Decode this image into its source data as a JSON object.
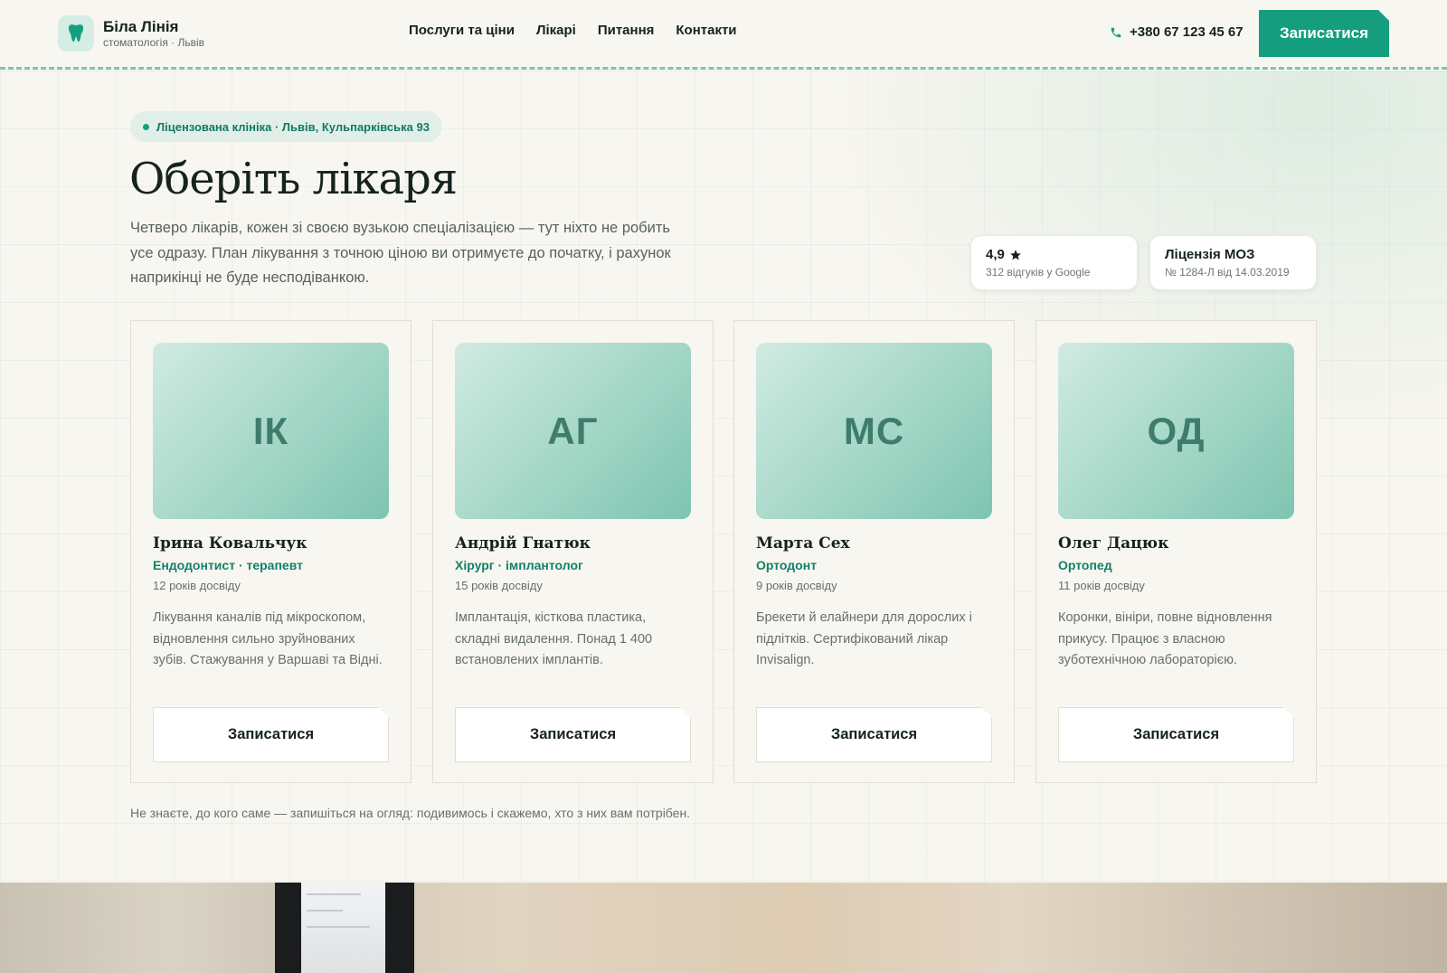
{
  "header": {
    "brand_name": "Біла Лінія",
    "brand_sub": "стоматологія · Львів",
    "nav": [
      "Послуги та ціни",
      "Лікарі",
      "Питання",
      "Контакти"
    ],
    "phone": "+380 67 123 45 67",
    "cta": "Записатися"
  },
  "hero": {
    "badge": "Ліцензована клініка · Львів, Кульпарківська 93",
    "title": "Оберіть лікаря",
    "lead": "Четверо лікарів, кожен зі своєю вузькою спеціалізацією — тут ніхто не робить усе одразу. План лікування з точною ціною ви отримуєте до початку, і рахунок наприкінці не буде несподіванкою."
  },
  "stats": [
    {
      "title": "4,9",
      "sub": "312 відгуків у Google"
    },
    {
      "title": "Ліцензія МОЗ",
      "sub": "№ 1284-Л від 14.03.2019"
    }
  ],
  "doctors": [
    {
      "initials": "ІК",
      "name": "Ірина Ковальчук",
      "spec": "Ендодонтист · терапевт",
      "exp": "12 років досвіду",
      "desc": "Лікування каналів під мікроскопом, відновлення сильно зруйнованих зубів. Стажування у Варшаві та Відні.",
      "button": "Записатися"
    },
    {
      "initials": "АГ",
      "name": "Андрій Гнатюк",
      "spec": "Хірург · імплантолог",
      "exp": "15 років досвіду",
      "desc": "Імплантація, кісткова пластика, складні видалення. Понад 1 400 встановлених імплантів.",
      "button": "Записатися"
    },
    {
      "initials": "МС",
      "name": "Марта Сех",
      "spec": "Ортодонт",
      "exp": "9 років досвіду",
      "desc": "Брекети й елайнери для дорослих і підлітків. Сертифікований лікар Invisalign.",
      "button": "Записатися"
    },
    {
      "initials": "ОД",
      "name": "Олег Дацюк",
      "spec": "Ортопед",
      "exp": "11 років досвіду",
      "desc": "Коронки, вініри, повне відновлення прикусу. Працює з власною зуботехнічною лабораторією.",
      "button": "Записатися"
    }
  ],
  "footnote": "Не знаєте, до кого саме — запишіться на огляд: подивимось і скажемо, хто з них вам потрібен.",
  "colors": {
    "accent": "#149e7d",
    "accent_text": "#138069",
    "background": "#f8f6f0"
  },
  "icons": {
    "logo": "tooth-icon",
    "phone": "phone-icon",
    "rating": "star-icon",
    "badge": "status-dot"
  }
}
